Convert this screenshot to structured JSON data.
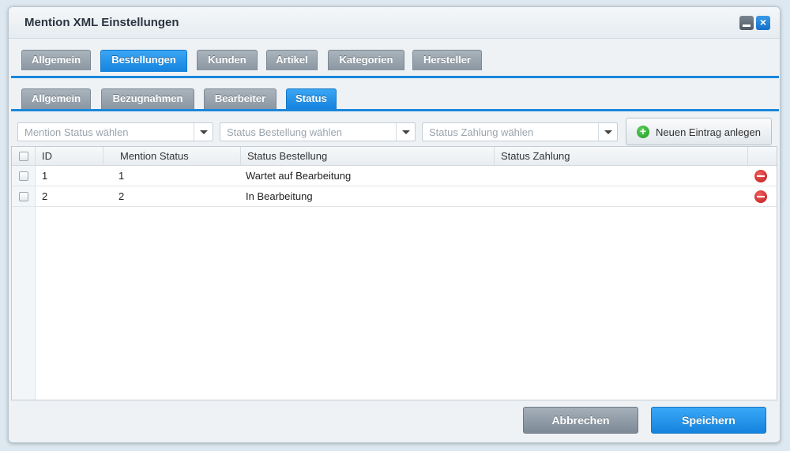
{
  "window": {
    "title": "Mention XML Einstellungen"
  },
  "main_tabs": [
    {
      "label": "Allgemein",
      "active": false
    },
    {
      "label": "Bestellungen",
      "active": true
    },
    {
      "label": "Kunden",
      "active": false
    },
    {
      "label": "Artikel",
      "active": false
    },
    {
      "label": "Kategorien",
      "active": false
    },
    {
      "label": "Hersteller",
      "active": false
    }
  ],
  "sub_tabs": [
    {
      "label": "Allgemein",
      "active": false
    },
    {
      "label": "Bezugnahmen",
      "active": false
    },
    {
      "label": "Bearbeiter",
      "active": false
    },
    {
      "label": "Status",
      "active": true
    }
  ],
  "toolbar": {
    "mention_status_placeholder": "Mention Status wählen",
    "status_bestellung_placeholder": "Status Bestellung wählen",
    "status_zahlung_placeholder": "Status Zahlung wählen",
    "new_entry_label": "Neuen Eintrag anlegen"
  },
  "grid": {
    "columns": [
      "ID",
      "Mention Status",
      "Status Bestellung",
      "Status Zahlung"
    ],
    "rows": [
      {
        "id": "1",
        "mention_status": "1",
        "status_bestellung": "Wartet auf Bearbeitung",
        "status_zahlung": ""
      },
      {
        "id": "2",
        "mention_status": "2",
        "status_bestellung": "In Bearbeitung",
        "status_zahlung": ""
      }
    ]
  },
  "footer": {
    "cancel_label": "Abbrechen",
    "save_label": "Speichern"
  },
  "colors": {
    "accent": "#1b87db",
    "tab_inactive": "#8a96a1",
    "delete": "#c01818",
    "add": "#1e9a1e"
  }
}
